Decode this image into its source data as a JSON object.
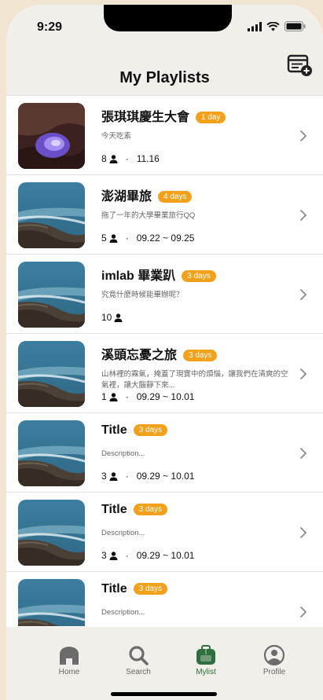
{
  "status": {
    "time": "9:29"
  },
  "header": {
    "title": "My Playlists"
  },
  "playlists": [
    {
      "title": "張琪琪慶生大會",
      "badge": "1 day",
      "description": "今天吃素",
      "members": "8",
      "dates": "11.16",
      "thumb": "purple-cave"
    },
    {
      "title": "澎湖畢旅",
      "badge": "4 days",
      "description": "拖了一年的大學畢業旅行QQ",
      "members": "5",
      "dates": "09.22 ~ 09.25",
      "thumb": "sea-rocks"
    },
    {
      "title": "imlab 畢業趴",
      "badge": "3 days",
      "description": "究竟什麼時候能畢辦呢？",
      "members": "10",
      "dates": "",
      "thumb": "sea-rocks"
    },
    {
      "title": "溪頭忘憂之旅",
      "badge": "3 days",
      "description": "山林裡的霧氣，掩蓋了現實中的煩惱，讓我們在清爽的空氣裡，讓大腦靜下來...",
      "members": "1",
      "dates": "09.29 ~ 10.01",
      "thumb": "sea-rocks"
    },
    {
      "title": "Title",
      "badge": "3 days",
      "description": "Description...",
      "members": "3",
      "dates": "09.29 ~ 10.01",
      "thumb": "sea-rocks"
    },
    {
      "title": "Title",
      "badge": "3 days",
      "description": "Description...",
      "members": "3",
      "dates": "09.29 ~ 10.01",
      "thumb": "sea-rocks"
    },
    {
      "title": "Title",
      "badge": "3 days",
      "description": "Description...",
      "members": "",
      "dates": "",
      "thumb": "sea-rocks"
    }
  ],
  "tabs": [
    {
      "label": "Home",
      "icon": "home-icon",
      "active": false
    },
    {
      "label": "Search",
      "icon": "search-icon",
      "active": false
    },
    {
      "label": "Mylist",
      "icon": "backpack-icon",
      "active": true
    },
    {
      "label": "Profile",
      "icon": "profile-icon",
      "active": false
    }
  ],
  "colors": {
    "accent": "#f3a11a",
    "active_tab": "#2f6e3f",
    "header_bg": "#f0efe9",
    "page_bg": "#f1e5d2"
  }
}
